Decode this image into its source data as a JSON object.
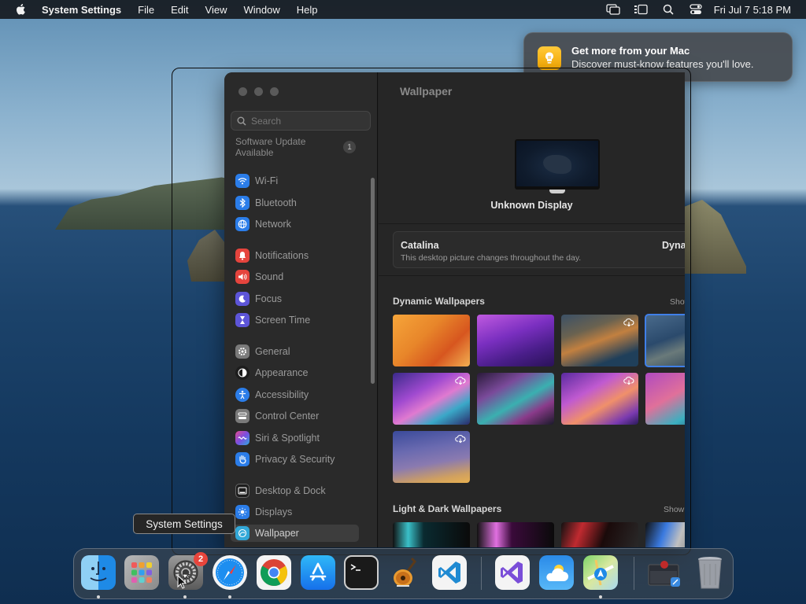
{
  "menubar": {
    "app_name": "System Settings",
    "menus": [
      "File",
      "Edit",
      "View",
      "Window",
      "Help"
    ],
    "clock": "Fri Jul 7  5:18 PM",
    "status_icons": [
      "screen-mirroring-icon",
      "stage-manager-icon",
      "spotlight-search-icon",
      "control-center-icon"
    ]
  },
  "notification": {
    "title": "Get more from your Mac",
    "body": "Discover must-know features you'll love."
  },
  "sidebar": {
    "search_placeholder": "Search",
    "update_label": "Software Update Available",
    "update_count": "1",
    "items": [
      {
        "label": "Wi-Fi",
        "icon": "wifi-icon",
        "color": "#2b7de9"
      },
      {
        "label": "Bluetooth",
        "icon": "bluetooth-icon",
        "color": "#2b7de9"
      },
      {
        "label": "Network",
        "icon": "globe-icon",
        "color": "#2b7de9"
      },
      {
        "label": "Notifications",
        "icon": "bell-icon",
        "color": "#e5443d"
      },
      {
        "label": "Sound",
        "icon": "speaker-icon",
        "color": "#e5443d"
      },
      {
        "label": "Focus",
        "icon": "moon-icon",
        "color": "#5d55d8"
      },
      {
        "label": "Screen Time",
        "icon": "hourglass-icon",
        "color": "#5d55d8"
      },
      {
        "label": "General",
        "icon": "gear-icon",
        "color": "#7a7a7a"
      },
      {
        "label": "Appearance",
        "icon": "appearance-icon",
        "color": "#1d1d1d"
      },
      {
        "label": "Accessibility",
        "icon": "accessibility-icon",
        "color": "#2b7de9"
      },
      {
        "label": "Control Center",
        "icon": "control-center-icon",
        "color": "#7a7a7a"
      },
      {
        "label": "Siri & Spotlight",
        "icon": "siri-icon",
        "color": "#c046d8"
      },
      {
        "label": "Privacy & Security",
        "icon": "hand-icon",
        "color": "#2b7de9"
      },
      {
        "label": "Desktop & Dock",
        "icon": "dock-icon",
        "color": "#1d1d1d"
      },
      {
        "label": "Displays",
        "icon": "sun-icon",
        "color": "#2b7de9"
      },
      {
        "label": "Wallpaper",
        "icon": "wallpaper-icon",
        "color": "#32a8d8"
      }
    ],
    "selected": "Wallpaper"
  },
  "main": {
    "title": "Wallpaper",
    "display_name": "Unknown Display",
    "current_wallpaper": {
      "name": "Catalina",
      "description": "This desktop picture changes throughout the day.",
      "mode": "Dyna"
    },
    "dynamic_section": {
      "title": "Dynamic Wallpapers",
      "show_all": "Show"
    },
    "light_dark_section": {
      "title": "Light & Dark Wallpapers",
      "show_all": "Show"
    }
  },
  "tooltip": "System Settings",
  "dock": {
    "apps": [
      {
        "name": "Finder",
        "running": true
      },
      {
        "name": "Launchpad",
        "running": false
      },
      {
        "name": "System Settings",
        "running": true,
        "badge": "2"
      },
      {
        "name": "Safari",
        "running": true
      },
      {
        "name": "Google Chrome",
        "running": false
      },
      {
        "name": "App Store",
        "running": false
      },
      {
        "name": "Terminal",
        "running": false
      },
      {
        "name": "GarageBand",
        "running": false
      },
      {
        "name": "Visual Studio Code",
        "running": false
      },
      {
        "name": "Visual Studio",
        "running": false
      },
      {
        "name": "Weather",
        "running": false
      },
      {
        "name": "Maps",
        "running": true
      },
      {
        "name": "Downloads",
        "running": false
      },
      {
        "name": "Trash",
        "running": false
      }
    ]
  }
}
